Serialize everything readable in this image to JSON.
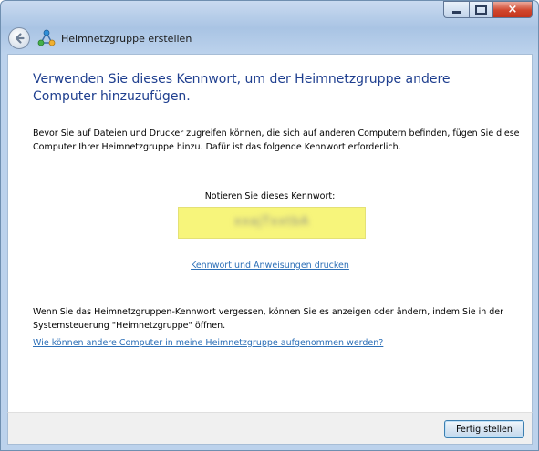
{
  "window": {
    "title": "Heimnetzgruppe erstellen",
    "controls": {
      "minimize": "minimize",
      "maximize": "maximize",
      "close": "×"
    }
  },
  "content": {
    "heading": "Verwenden Sie dieses Kennwort, um der Heimnetzgruppe andere Computer hinzuzufügen.",
    "description": "Bevor Sie auf Dateien und Drucker zugreifen können, die sich auf anderen Computern befinden, fügen Sie diese Computer Ihrer Heimnetzgruppe hinzu. Dafür ist das folgende Kennwort erforderlich.",
    "password_label": "Notieren Sie dieses Kennwort:",
    "password_value": "xxajTxxtbA",
    "print_link": "Kennwort und Anweisungen drucken",
    "note": "Wenn Sie das Heimnetzgruppen-Kennwort vergessen, können Sie es anzeigen oder ändern, indem Sie in der Systemsteuerung \"Heimnetzgruppe\" öffnen.",
    "help_link": "Wie können andere Computer in meine Heimnetzgruppe aufgenommen werden?"
  },
  "footer": {
    "finish_button": "Fertig stellen"
  },
  "colors": {
    "heading": "#1f3f8f",
    "link": "#2c6fb7",
    "password_highlight": "#f7f57b"
  }
}
